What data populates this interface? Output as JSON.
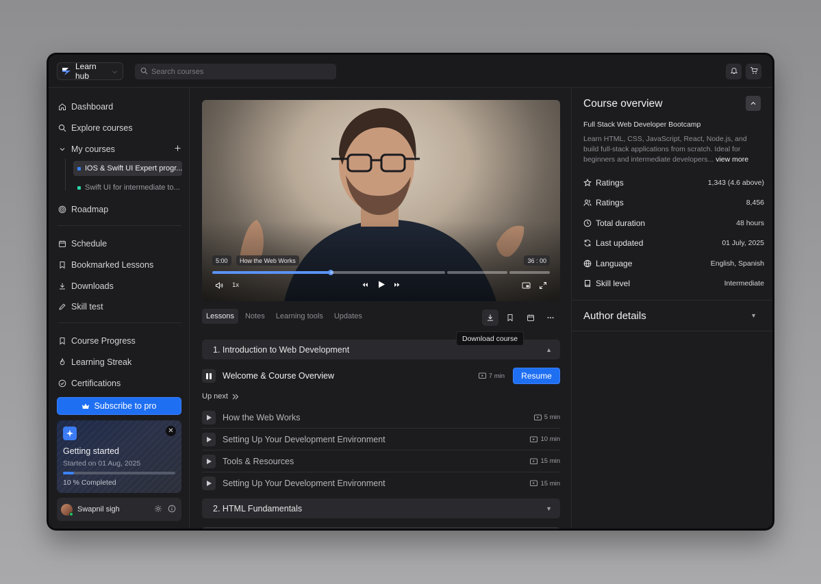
{
  "app": {
    "name": "Learn hub"
  },
  "search": {
    "placeholder": "Search courses"
  },
  "sidebar": {
    "nav": [
      "Dashboard",
      "Explore courses",
      "My courses"
    ],
    "my_courses": [
      "IOS & Swift UI Expert progr...",
      "Swift UI for intermediate to..."
    ],
    "roadmap": "Roadmap",
    "group2": [
      "Schedule",
      "Bookmarked Lessons",
      "Downloads",
      "Skill test"
    ],
    "group3": [
      "Course Progress",
      "Learning Streak",
      "Certifications"
    ],
    "subscribe_label": "Subscribe to pro",
    "getting_started": {
      "title": "Getting started",
      "subtitle": "Started on 01 Aug, 2025",
      "progress": 0.1,
      "progress_label": "10 % Completed"
    },
    "user": {
      "name": "Swapnil sigh"
    }
  },
  "video": {
    "current_time": "5:00",
    "chapter": "How the Web Works",
    "total_time": "36 : 00",
    "speed": "1x",
    "progress": 0.35
  },
  "tabs": [
    "Lessons",
    "Notes",
    "Learning tools",
    "Updates"
  ],
  "tooltip": "Download course",
  "sections": [
    {
      "title": "1. Introduction to Web Development"
    },
    {
      "title": "2. HTML Fundamentals"
    }
  ],
  "current_lesson": {
    "title": "Welcome & Course Overview",
    "duration": "7 min",
    "action": "Resume"
  },
  "up_next_label": "Up next",
  "lessons": [
    {
      "title": "How the Web Works",
      "duration": "5 min"
    },
    {
      "title": "Setting Up Your Development Environment",
      "duration": "10 min"
    },
    {
      "title": "Tools & Resources",
      "duration": "15 min"
    },
    {
      "title": "Setting Up Your Development Environment",
      "duration": "15 min"
    }
  ],
  "overview": {
    "title": "Course overview",
    "course_name": "Full Stack Web Developer Bootcamp",
    "description": "Learn HTML, CSS, JavaScript, React, Node.js, and build full-stack applications from scratch. Ideal for beginners and intermediate developers...",
    "view_more": "view more",
    "stats": [
      {
        "label": "Ratings",
        "value": "1,343  (4.6 above)",
        "icon": "star-icon"
      },
      {
        "label": "Ratings",
        "value": "8,456",
        "icon": "users-icon"
      },
      {
        "label": "Total duration",
        "value": "48 hours",
        "icon": "clock-icon"
      },
      {
        "label": "Last updated",
        "value": "01 July, 2025",
        "icon": "refresh-icon"
      },
      {
        "label": "Language",
        "value": "English, Spanish",
        "icon": "globe-icon"
      },
      {
        "label": "Skill level",
        "value": "Intermediate",
        "icon": "book-icon"
      }
    ],
    "author_title": "Author details"
  },
  "colors": {
    "accent": "#1f6ff2",
    "background": "#1c1c1f",
    "panel": "#2a2a2e"
  }
}
